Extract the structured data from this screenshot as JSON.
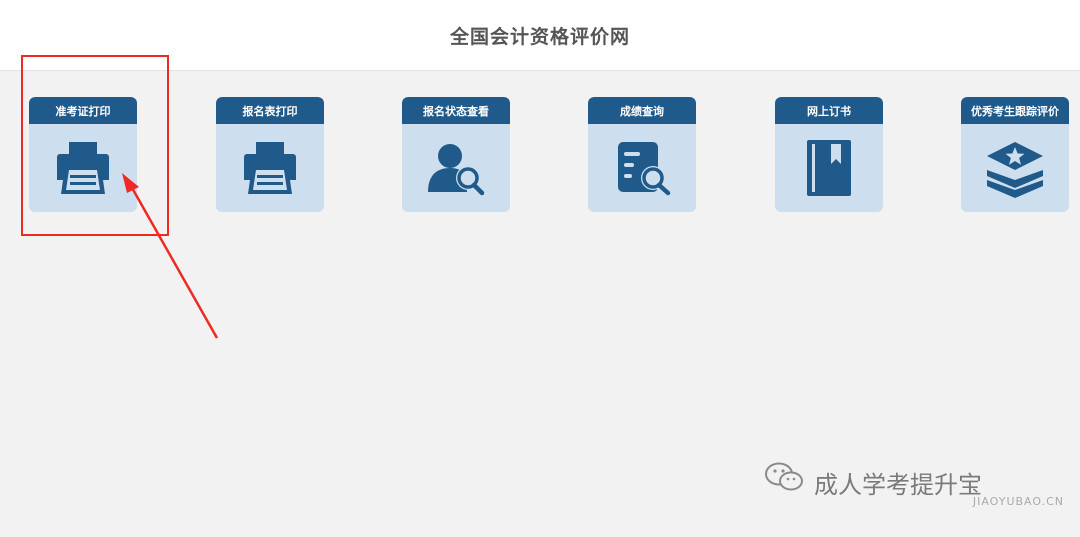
{
  "header": {
    "title": "全国会计资格评价网"
  },
  "cards": [
    {
      "label": "准考证打印",
      "icon": "printer-icon"
    },
    {
      "label": "报名表打印",
      "icon": "printer-icon"
    },
    {
      "label": "报名状态查看",
      "icon": "user-search-icon"
    },
    {
      "label": "成绩查询",
      "icon": "document-search-icon"
    },
    {
      "label": "网上订书",
      "icon": "book-icon"
    },
    {
      "label": "优秀考生跟踪评价",
      "icon": "layers-star-icon"
    }
  ],
  "watermark": {
    "text": "成人学考提升宝",
    "domain": "JIAOYUBAO.CN"
  },
  "colors": {
    "card_header": "#1f5a8a",
    "card_body": "#cddfee",
    "highlight": "#ee2a24",
    "background": "#f2f2f2"
  }
}
